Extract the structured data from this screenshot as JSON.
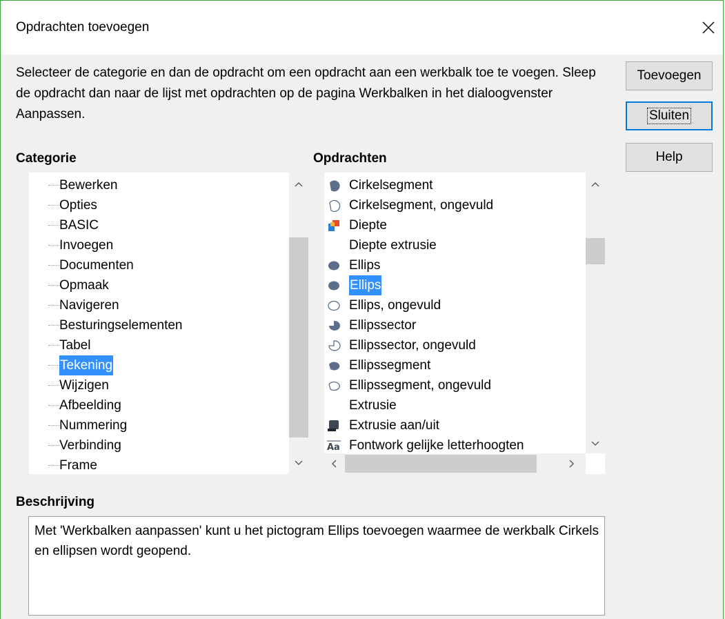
{
  "dialog": {
    "title": "Opdrachten toevoegen",
    "intro_text": "Selecteer de categorie en dan de opdracht om een opdracht aan een werkbalk toe te voegen. Sleep de opdracht dan naar de lijst met opdrachten op de pagina Werkbalken in het dialoogvenster Aanpassen."
  },
  "buttons": {
    "add": "Toevoegen",
    "close": "Sluiten",
    "help": "Help"
  },
  "category": {
    "heading": "Categorie",
    "items": [
      "Bewerken",
      "Opties",
      "BASIC",
      "Invoegen",
      "Documenten",
      "Opmaak",
      "Navigeren",
      "Besturingselementen",
      "Tabel",
      "Tekening",
      "Wijzigen",
      "Afbeelding",
      "Nummering",
      "Verbinding",
      "Frame"
    ],
    "selected": "Tekening"
  },
  "commands": {
    "heading": "Opdrachten",
    "items": [
      {
        "label": "Cirkelsegment",
        "icon": "circle-segment-filled-icon"
      },
      {
        "label": "Cirkelsegment, ongevuld",
        "icon": "circle-segment-outline-icon"
      },
      {
        "label": "Diepte",
        "icon": "depth-3d-icon"
      },
      {
        "label": "Diepte extrusie",
        "icon": ""
      },
      {
        "label": "Ellips",
        "icon": "ellipse-filled-icon"
      },
      {
        "label": "Ellips",
        "icon": "ellipse-filled-icon"
      },
      {
        "label": "Ellips, ongevuld",
        "icon": "ellipse-outline-icon"
      },
      {
        "label": "Ellipssector",
        "icon": "ellipse-sector-filled-icon"
      },
      {
        "label": "Ellipssector, ongevuld",
        "icon": "ellipse-sector-outline-icon"
      },
      {
        "label": "Ellipssegment",
        "icon": "ellipse-segment-filled-icon"
      },
      {
        "label": "Ellipssegment, ongevuld",
        "icon": "ellipse-segment-outline-icon"
      },
      {
        "label": "Extrusie",
        "icon": ""
      },
      {
        "label": "Extrusie aan/uit",
        "icon": "extrusion-toggle-icon"
      },
      {
        "label": "Fontwork gelijke letterhoogten",
        "icon": "fontwork-same-height-icon"
      }
    ],
    "selected_index": 5
  },
  "description": {
    "heading": "Beschrijving",
    "text": "Met 'Werkbalken aanpassen' kunt u het pictogram Ellips toevoegen waarmee de werkbalk Cirkels en ellipsen wordt geopend."
  },
  "colors": {
    "selection": "#3390ff",
    "icon_fill": "#5b6f8a"
  }
}
